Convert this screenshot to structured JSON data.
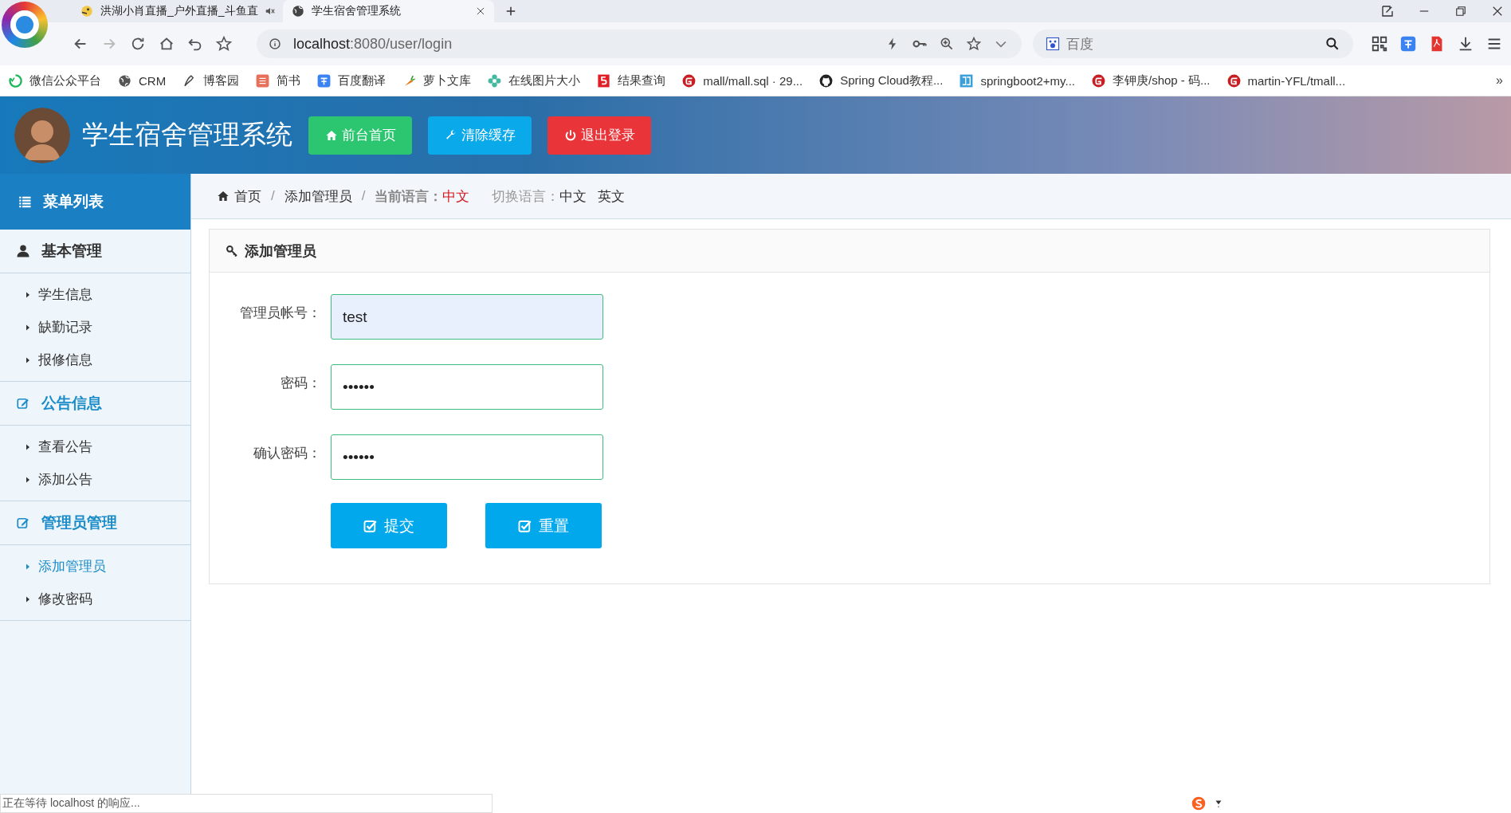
{
  "browser": {
    "tabs": [
      {
        "title": "洪湖小肖直播_户外直播_斗鱼直",
        "selected": false,
        "muted": true
      },
      {
        "title": "学生宿舍管理系统",
        "selected": true,
        "muted": false
      }
    ],
    "address": {
      "host": "localhost",
      "rest": ":8080/user/login"
    },
    "search": {
      "placeholder": "百度"
    },
    "bookmarks": [
      "微信公众平台",
      "CRM",
      "博客园",
      "简书",
      "百度翻译",
      "萝卜文库",
      "在线图片大小",
      "结果查询",
      "mall/mall.sql · 29...",
      "Spring Cloud教程...",
      "springboot2+my...",
      "李钾庚/shop - 码...",
      "martin-YFL/tmall..."
    ],
    "more": "»"
  },
  "header": {
    "title": "学生宿舍管理系统",
    "buttons": [
      {
        "label": "前台首页",
        "color": "#2bc66f"
      },
      {
        "label": "清除缓存",
        "color": "#0aa9ea"
      },
      {
        "label": "退出登录",
        "color": "#e93439"
      }
    ]
  },
  "sidebar": {
    "title": "菜单列表",
    "groups": [
      {
        "title": "基本管理",
        "color": "#333333",
        "items": [
          {
            "label": "学生信息",
            "selected": false
          },
          {
            "label": "缺勤记录",
            "selected": false
          },
          {
            "label": "报修信息",
            "selected": false
          }
        ]
      },
      {
        "title": "公告信息",
        "color": "#1a8cc8",
        "items": [
          {
            "label": "查看公告",
            "selected": false
          },
          {
            "label": "添加公告",
            "selected": false
          }
        ]
      },
      {
        "title": "管理员管理",
        "color": "#1a8cc8",
        "items": [
          {
            "label": "添加管理员",
            "selected": true
          },
          {
            "label": "修改密码",
            "selected": false
          }
        ]
      }
    ]
  },
  "breadcrumb": {
    "separator": "/",
    "items": [
      "首页",
      "添加管理员"
    ],
    "current_label": "当前语言：",
    "current_value": "中文",
    "switch_label": "切换语言：",
    "languages": [
      "中文",
      "英文"
    ]
  },
  "form": {
    "title": "添加管理员",
    "fields": [
      {
        "label": "管理员帐号：",
        "value": "test",
        "focused": true
      },
      {
        "label": "密码：",
        "value": "••••••",
        "focused": false
      },
      {
        "label": "确认密码：",
        "value": "••••••",
        "focused": false
      }
    ],
    "buttons": [
      "提交",
      "重置"
    ]
  },
  "status": "正在等待 localhost 的响应..."
}
